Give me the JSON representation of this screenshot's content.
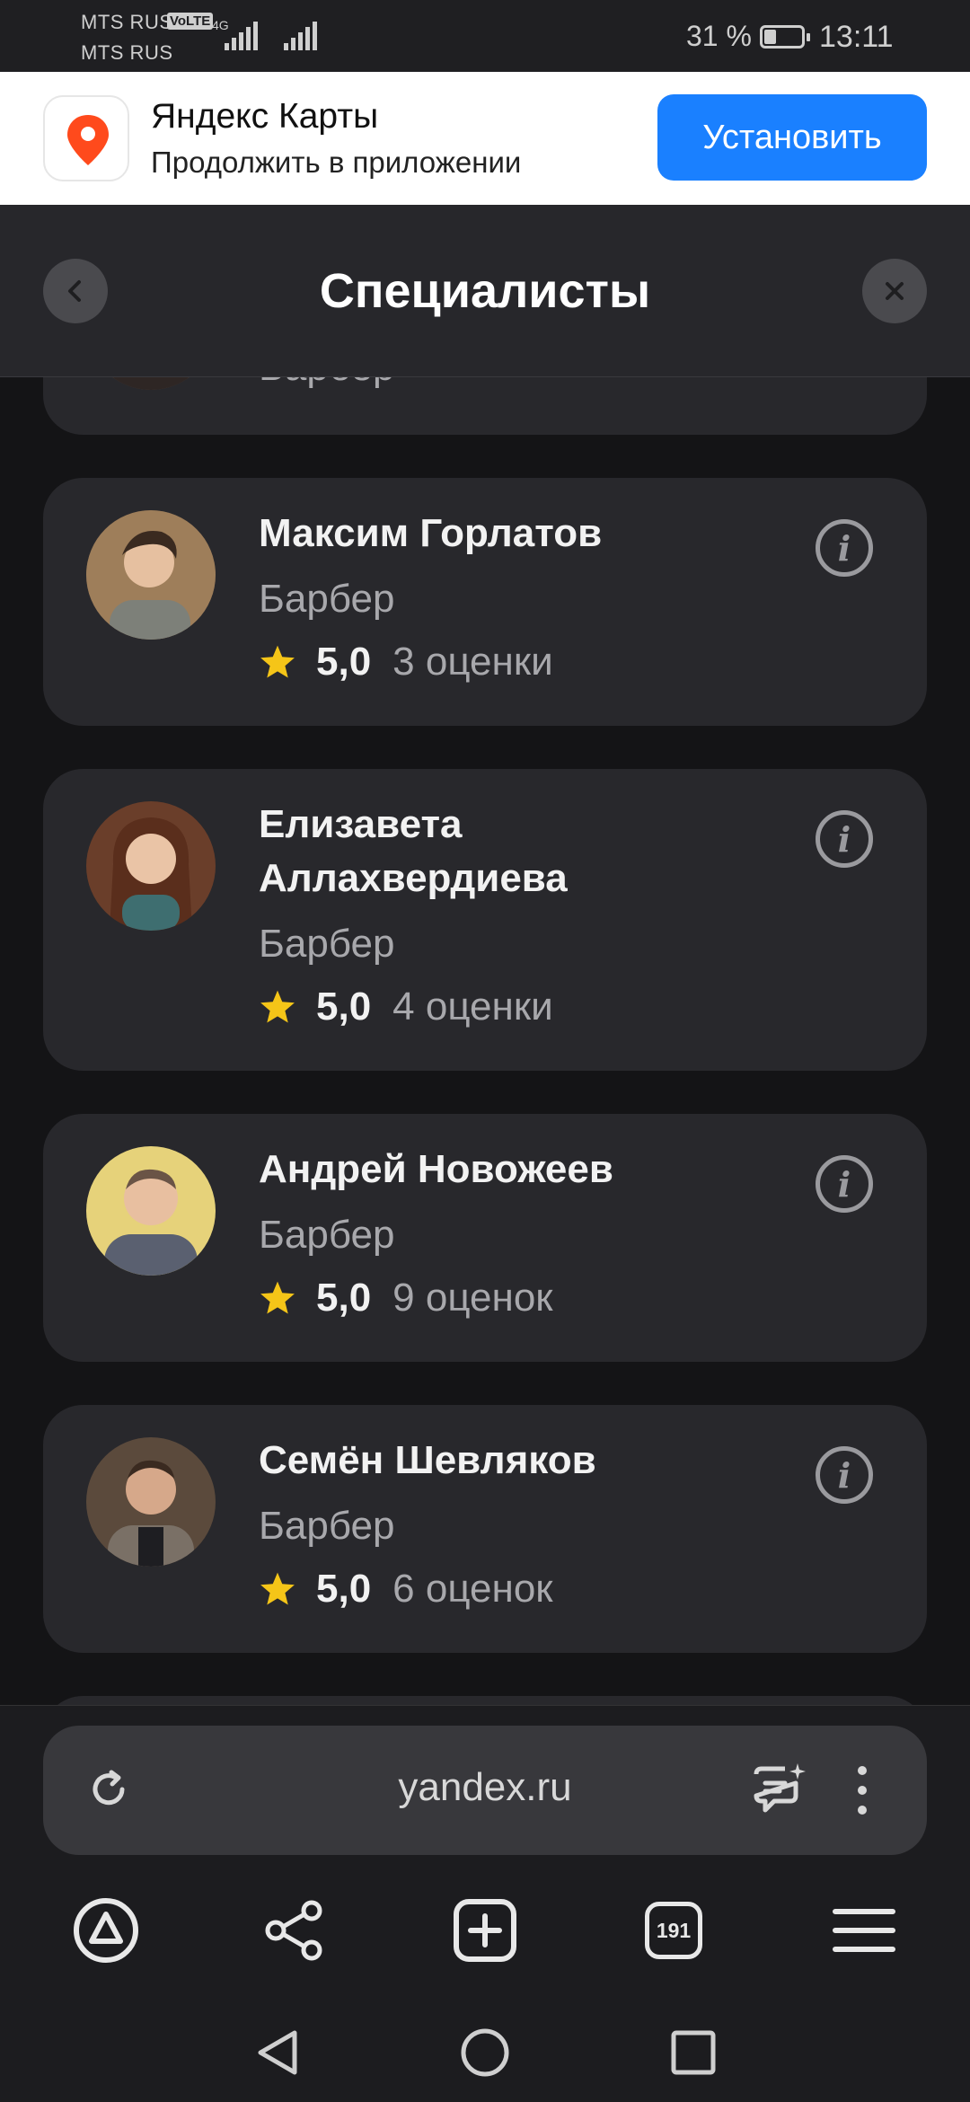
{
  "status_bar": {
    "operator1": "MTS RUS",
    "volte": "VoLTE",
    "network": "4G",
    "operator2": "MTS RUS",
    "battery": "31 %",
    "battery_fraction": 0.31,
    "time": "13:11"
  },
  "app_banner": {
    "app_name": "Яндекс Карты",
    "subtitle": "Продолжить в приложении",
    "install_label": "Установить",
    "accent": "#1a80ff"
  },
  "header": {
    "title": "Специалисты",
    "back_icon": "chevron-left-icon",
    "close_icon": "close-icon"
  },
  "partial_card": {
    "role": "Барбер"
  },
  "specialists": [
    {
      "name": "Максим Горлатов",
      "role": "Барбер",
      "score": "5,0",
      "ratings_count": "3 оценки"
    },
    {
      "name_line1": "Елизавета",
      "name_line2": "Аллахвердиева",
      "role": "Барбер",
      "score": "5,0",
      "ratings_count": "4 оценки"
    },
    {
      "name": "Андрей Новожеев",
      "role": "Барбер",
      "score": "5,0",
      "ratings_count": "9 оценок"
    },
    {
      "name": "Семён Шевляков",
      "role": "Барбер",
      "score": "5,0",
      "ratings_count": "6 оценок"
    }
  ],
  "browser": {
    "url": "yandex.ru",
    "tabs_count": "191",
    "icons": [
      "reload-icon",
      "ai-chat-icon",
      "more-icon",
      "alice-icon",
      "share-icon",
      "new-tab-icon",
      "tabs-icon",
      "menu-icon"
    ]
  },
  "system_nav": [
    "back-icon",
    "home-icon",
    "recents-icon"
  ],
  "colors": {
    "star": "#f5c518",
    "card_bg": "#28282c",
    "page_bg": "#141416"
  }
}
